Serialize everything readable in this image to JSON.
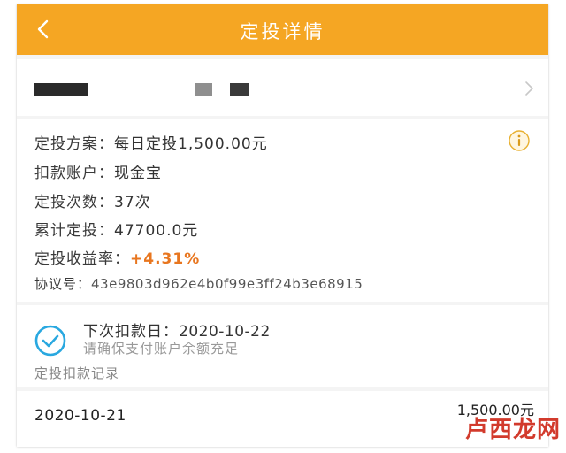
{
  "header": {
    "title": "定投详情",
    "back_icon": "chevron-left-icon",
    "color": "#f5a623"
  },
  "account": {
    "chevron_icon": "chevron-right-icon"
  },
  "plan": {
    "plan_label": "定投方案：",
    "plan_value": "每日定投1,500.00元",
    "account_label": "扣款账户：",
    "account_value": "现金宝",
    "count_label": "定投次数：",
    "count_value": "37次",
    "total_label": "累计定投：",
    "total_value": "47700.0元",
    "yield_label": "定投收益率：",
    "yield_value": "+4.31%",
    "yield_color": "#e8761f",
    "protocol_label": "协议号：",
    "protocol_value": "43e9803d962e4b0f99e3ff24b3e68915",
    "info_icon": "info-icon"
  },
  "next_debit": {
    "label": "下次扣款日：",
    "date": "2020-10-22",
    "note": "请确保支付账户余额充足",
    "check_icon": "check-circle-icon",
    "check_color": "#29a8e0"
  },
  "records": {
    "section_label": "定投扣款记录",
    "items": [
      {
        "date": "2020-10-21",
        "amount": "1,500.00元"
      }
    ]
  },
  "watermark": "卢西龙网"
}
